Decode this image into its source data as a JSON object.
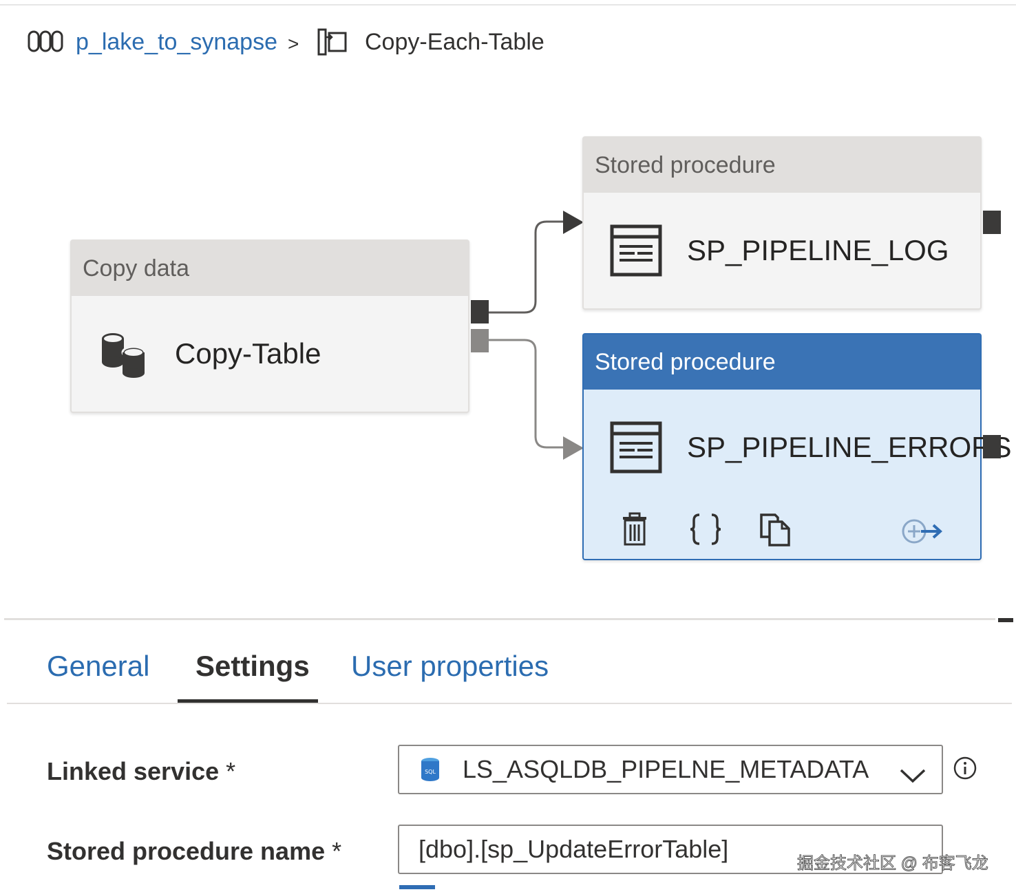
{
  "breadcrumb": {
    "pipeline_name": "p_lake_to_synapse",
    "separator": ">",
    "activity_name": "Copy-Each-Table",
    "pipeline_icon": "pipeline-icon",
    "foreach_icon": "foreach-icon"
  },
  "canvas": {
    "copy_node": {
      "type_label": "Copy data",
      "name": "Copy-Table",
      "icon": "database-icon"
    },
    "sp_log_node": {
      "type_label": "Stored procedure",
      "name": "SP_PIPELINE_LOG",
      "icon": "stored-procedure-icon"
    },
    "sp_errors_node": {
      "type_label": "Stored procedure",
      "name": "SP_PIPELINE_ERRORS",
      "icon": "stored-procedure-icon",
      "actions": [
        "trash-icon",
        "code-braces-icon",
        "copy-icon",
        "add-output-icon"
      ]
    }
  },
  "panel": {
    "tabs": [
      {
        "label": "General",
        "active": false
      },
      {
        "label": "Settings",
        "active": true
      },
      {
        "label": "User properties",
        "active": false
      }
    ],
    "linked_service": {
      "label": "Linked service",
      "required_mark": "*",
      "value": "LS_ASQLDB_PIPELNE_METADATA"
    },
    "stored_procedure": {
      "label": "Stored procedure name",
      "required_mark": "*",
      "value": "[dbo].[sp_UpdateErrorTable]"
    }
  },
  "watermark": "掘金技术社区 @ 布客飞龙",
  "colors": {
    "link": "#2b6cb0",
    "selected_header": "#3a73b5",
    "selected_body": "#deecf9"
  }
}
